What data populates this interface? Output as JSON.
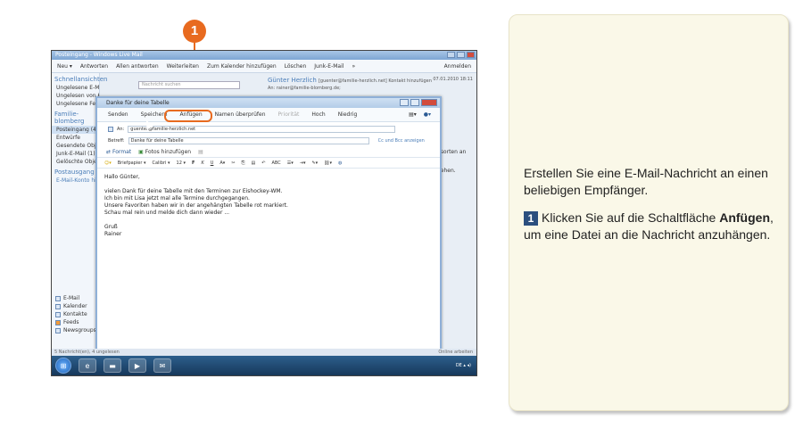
{
  "callout": {
    "number": "1"
  },
  "window": {
    "title": "Posteingang - Windows Live Mail",
    "menu": [
      "Neu ▾",
      "Antworten",
      "Allen antworten",
      "Weiterleiten",
      "Zum Kalender hinzufügen",
      "Löschen",
      "Junk-E-Mail",
      "»"
    ],
    "menu_right": "Anmelden",
    "search_placeholder": "Nachricht suchen",
    "status_left": "5 Nachricht(en), 4 ungelesen",
    "status_right": "Online arbeiten",
    "tray_text": "DE ▴ ◂)"
  },
  "sidebar": {
    "section1": "Schnellansichten",
    "items1": [
      "Ungelesene E-Mails (4)",
      "Ungelesen von Kontakten",
      "Ungelesene Feeds"
    ],
    "section2": "Familie-blomberg",
    "items2": [
      "Posteingang (4)",
      "Entwürfe",
      "Gesendete Objekte",
      "Junk-E-Mail (1)",
      "Gelöschte Objekte"
    ],
    "section3": "Postausgang",
    "items3": [
      "E-Mail-Konto hinzufügen"
    ],
    "nav": [
      "E-Mail",
      "Kalender",
      "Kontakte",
      "Feeds",
      "Newsgroups"
    ]
  },
  "reading": {
    "from": "Günter Herzlich",
    "from_detail": "[guenter@familie-herzlich.net]  Kontakt hinzufügen",
    "to": "An: rainer@familie-blomberg.de;",
    "date": "07.01.2010 18:11",
    "snip1": "gsorten an",
    "snip2": "gehen."
  },
  "compose": {
    "title": "Danke für deine Tabelle",
    "toolbar": [
      "Senden",
      "Speichern",
      "Anfügen",
      "Namen überprüfen"
    ],
    "toolbar_disabled": "Priorität",
    "toolbar_more": [
      "Hoch",
      "Niedrig"
    ],
    "to_label": "An:",
    "to_value": "guenter@familie-herzlich.net",
    "subject_label": "Betreff:",
    "subject_value": "Danke für deine Tabelle",
    "cc_link": "Cc und Bcc anzeigen",
    "format_label": "Format",
    "photos_label": "Fotos hinzufügen",
    "stationery": "Briefpapier ▾",
    "font": "Calibri ▾",
    "size": "12 ▾",
    "body": [
      "Hallo Günter,",
      "",
      "vielen Dank für deine Tabelle mit den Terminen zur Eishockey-WM.",
      "Ich bin mit Lisa jetzt mal alle Termine durchgegangen.",
      "Unsere Favoriten haben wir in der angehängten Tabelle rot markiert.",
      "Schau mal rein und melde dich dann wieder ...",
      "",
      "Gruß",
      "Rainer"
    ]
  },
  "instructions": {
    "intro": "Erstellen Sie eine E-Mail-Nachricht an einen beliebigen Empfänger.",
    "step_number": "1",
    "step_pre": "Klicken Sie auf die Schaltfläche ",
    "step_bold": "Anfügen",
    "step_post": ", um eine Datei an die Nachricht anzuhängen."
  },
  "colors": {
    "accent": "#e86a1f",
    "step_box": "#2b4f7e",
    "panel_bg": "#faf8e8"
  }
}
